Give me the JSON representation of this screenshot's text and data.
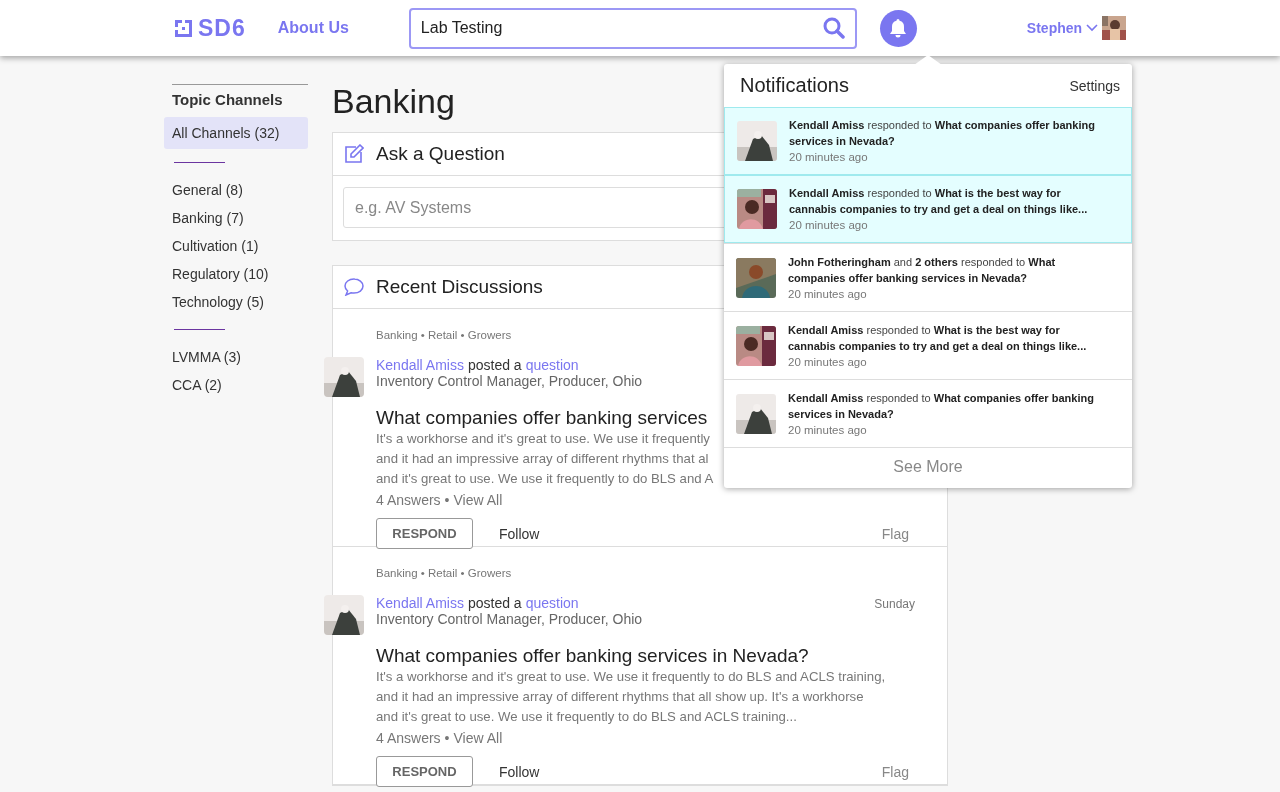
{
  "header": {
    "logo": "SD6",
    "nav": "About Us",
    "search": {
      "value": "Lab Testing"
    },
    "bell": {
      "active": true
    },
    "user": {
      "name": "Stephen"
    }
  },
  "sidebar": {
    "title": "Topic Channels",
    "sections": [
      {
        "items": [
          {
            "label": "All Channels (32)",
            "selected": true
          }
        ]
      },
      {
        "items": [
          {
            "label": "General (8)",
            "selected": false
          },
          {
            "label": "Banking (7)",
            "selected": false
          },
          {
            "label": "Cultivation (1)",
            "selected": false
          },
          {
            "label": "Regulatory (10)",
            "selected": false
          },
          {
            "label": "Technology (5)",
            "selected": false
          }
        ]
      },
      {
        "items": [
          {
            "label": "LVMMA (3)",
            "selected": false
          },
          {
            "label": "CCA (2)",
            "selected": false
          }
        ]
      }
    ]
  },
  "page_title": "Banking",
  "ask": {
    "title": "Ask a Question",
    "placeholder": "e.g. AV Systems"
  },
  "discussions": {
    "title": "Recent Discussions",
    "posts": [
      {
        "tags": "Banking • Retail • Growers",
        "author": "Kendall Amiss",
        "action": "posted a",
        "link": "question",
        "role": "Inventory Control Manager, Producer, Ohio",
        "title": "What companies offer banking services",
        "body": [
          "It's a workhorse and it's great to use. We use it frequently",
          "and it had an impressive array of different rhythms that al",
          "and it's great to use. We use it frequently to do BLS and A"
        ],
        "answers": "4 Answers",
        "separator": "•",
        "view_all": "View All",
        "respond": "RESPOND",
        "follow": "Follow",
        "flag": "Flag"
      },
      {
        "tags": "Banking • Retail • Growers",
        "author": "Kendall Amiss",
        "action": "posted a",
        "link": "question",
        "role": "Inventory Control Manager, Producer, Ohio",
        "date": "Sunday",
        "title": "What companies offer banking services in Nevada?",
        "body": [
          "It's a workhorse and it's great to use. We use it frequently to do BLS and ACLS training,",
          "and it had an impressive array of different rhythms that all show up. It's a workhorse",
          "and it's great to use. We use it frequently to do BLS and ACLS training..."
        ],
        "answers": "4 Answers",
        "separator": "•",
        "view_all": "View All",
        "respond": "RESPOND",
        "follow": "Follow",
        "flag": "Flag"
      }
    ]
  },
  "notifications": {
    "title": "Notifications",
    "settings": "Settings",
    "items": [
      {
        "text": "**Kendall Amiss** responded to **What companies offer banking services in Nevada?**",
        "time": "20 minutes ago",
        "unread": true
      },
      {
        "text": "**Kendall Amiss** responded to **What is the best way for cannabis companies to try and get a deal on things like...**",
        "time": "20 minutes ago",
        "unread": true
      },
      {
        "text": "**John Fotheringham** and **2 others** responded to **What companies offer banking services in Nevada?**",
        "time": "20 minutes ago",
        "unread": false
      },
      {
        "text": "**Kendall Amiss** responded to **What is the best way for cannabis companies to try and get a deal on things like...**",
        "time": "20 minutes ago",
        "unread": false
      },
      {
        "text": "**Kendall Amiss** responded to **What companies offer banking services in Nevada?**",
        "time": "20 minutes ago",
        "unread": false
      }
    ],
    "see_more": "See More"
  }
}
